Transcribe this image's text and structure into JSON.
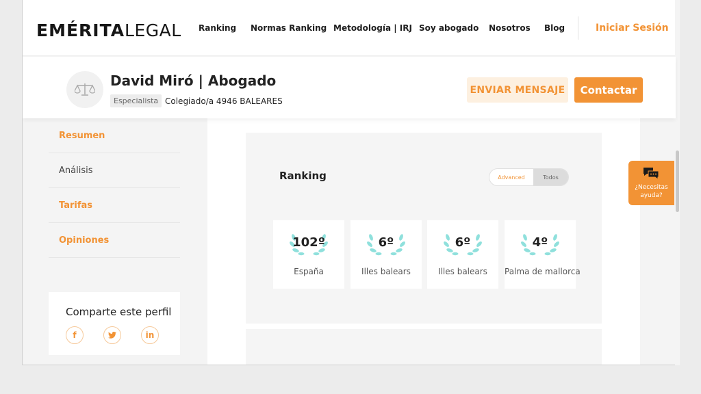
{
  "brand": {
    "logo_bold": "EMÉRITA",
    "logo_light": "LEGAL"
  },
  "nav": {
    "links": [
      "Ranking",
      "Normas Ranking",
      "Metodología | IRJ",
      "Soy abogado",
      "Nosotros",
      "Blog"
    ],
    "login": "Iniciar Sesión"
  },
  "profile": {
    "name": "David Miró | Abogado",
    "badge": "Especialista",
    "colegiado": "Colegiado/a 4946 BALEARES",
    "send_message": "ENVIAR MENSAJE",
    "contact": "Contactar"
  },
  "sidebar": {
    "items": [
      "Resumen",
      "Análisis",
      "Tarifas",
      "Opiniones"
    ]
  },
  "share": {
    "title": "Comparte este perfil"
  },
  "ranking": {
    "title": "Ranking",
    "toggle": [
      "Advanced",
      "Todos"
    ],
    "tiles": [
      {
        "value": "102º",
        "label": "España"
      },
      {
        "value": "6º",
        "label": "Illes balears"
      },
      {
        "value": "6º",
        "label": "Illes balears"
      },
      {
        "value": "4º",
        "label": "Palma de mallorca"
      }
    ]
  },
  "help": {
    "line1": "¿Necesitas",
    "line2": "ayuda?"
  },
  "colors": {
    "accent": "#f29335",
    "laurel": "#8fe0dc"
  }
}
